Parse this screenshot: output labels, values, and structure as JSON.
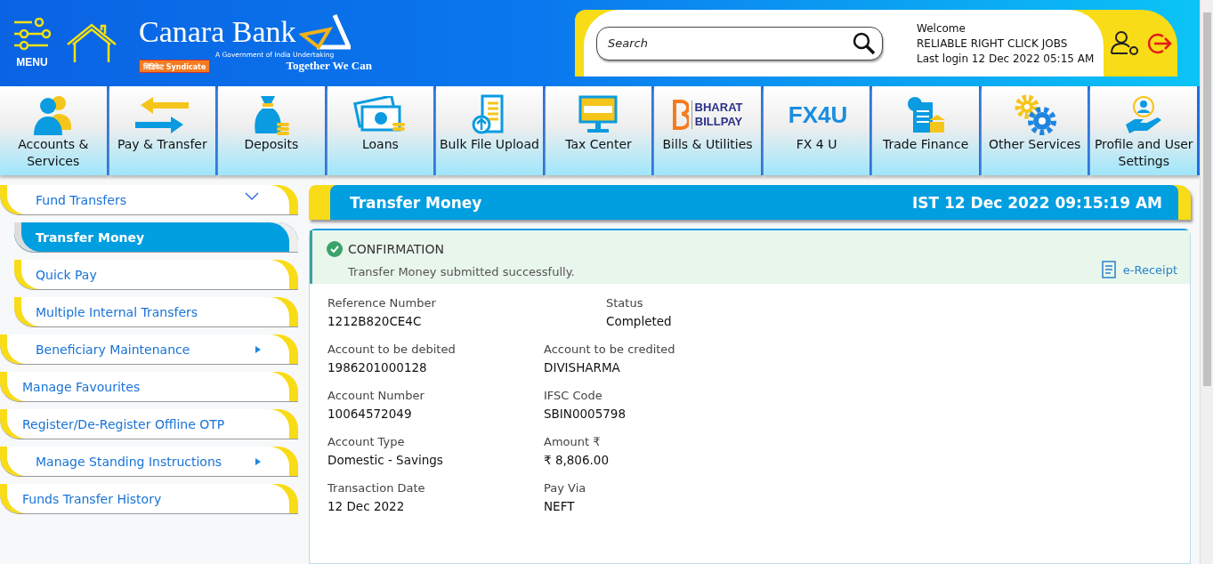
{
  "header": {
    "menu_label": "MENU",
    "brand": {
      "name": "Canara Bank",
      "subtitle": "A Government of India Undertaking",
      "partner": "सिंडिकेट Syndicate",
      "tagline": "Together We Can"
    },
    "search": {
      "placeholder": "Search"
    },
    "user": {
      "welcome": "Welcome",
      "name": "RELIABLE RIGHT CLICK JOBS",
      "last_login": "Last login 12 Dec 2022 05:15 AM"
    }
  },
  "nav": [
    {
      "label": "Accounts & Services"
    },
    {
      "label": "Pay & Transfer"
    },
    {
      "label": "Deposits"
    },
    {
      "label": "Loans"
    },
    {
      "label": "Bulk File Upload"
    },
    {
      "label": "Tax Center"
    },
    {
      "label": "Bills & Utilities",
      "logo_lines": [
        "BHARAT",
        "BILLPAY"
      ]
    },
    {
      "label": "FX 4 U",
      "logo_lines": [
        "FX4U"
      ]
    },
    {
      "label": "Trade Finance"
    },
    {
      "label": "Other Services"
    },
    {
      "label": "Profile and User Settings"
    }
  ],
  "sidebar": {
    "items": [
      {
        "label": "Fund Transfers",
        "kind": "group",
        "expanded": true,
        "selected": false,
        "children": [
          {
            "label": "Transfer Money",
            "selected": true
          },
          {
            "label": "Quick Pay",
            "selected": false
          },
          {
            "label": "Multiple Internal Transfers",
            "selected": false
          }
        ]
      },
      {
        "label": "Beneficiary Maintenance",
        "kind": "group",
        "expanded": false,
        "selected": false
      },
      {
        "label": "Manage Favourites",
        "kind": "link",
        "selected": false
      },
      {
        "label": "Register/De-Register Offline OTP",
        "kind": "link",
        "selected": false
      },
      {
        "label": "Manage Standing Instructions",
        "kind": "group",
        "expanded": false,
        "selected": false
      },
      {
        "label": "Funds Transfer History",
        "kind": "link",
        "selected": false
      }
    ]
  },
  "content": {
    "title": "Transfer Money",
    "timestamp": "IST 12 Dec 2022 09:15:19 AM",
    "confirmation": {
      "heading": "CONFIRMATION",
      "message": "Transfer Money submitted successfully.",
      "receipt_link": "e-Receipt"
    },
    "details": [
      [
        {
          "label": "Reference Number",
          "value": "1212B820CE4C"
        },
        {
          "label": "Status",
          "value": "Completed"
        }
      ],
      [
        {
          "label": "Account to be debited",
          "value": "1986201000128"
        },
        {
          "label": "Account to be credited",
          "value": "DIVISHARMA"
        }
      ],
      [
        {
          "label": "Account Number",
          "value": "10064572049"
        },
        {
          "label": "IFSC Code",
          "value": "SBIN0005798"
        }
      ],
      [
        {
          "label": "Account Type",
          "value": "Domestic - Savings"
        },
        {
          "label": "Amount ₹",
          "value": "₹ 8,806.00"
        }
      ],
      [
        {
          "label": "Transaction Date",
          "value": "12 Dec 2022"
        },
        {
          "label": "Pay Via",
          "value": "NEFT"
        }
      ]
    ]
  }
}
